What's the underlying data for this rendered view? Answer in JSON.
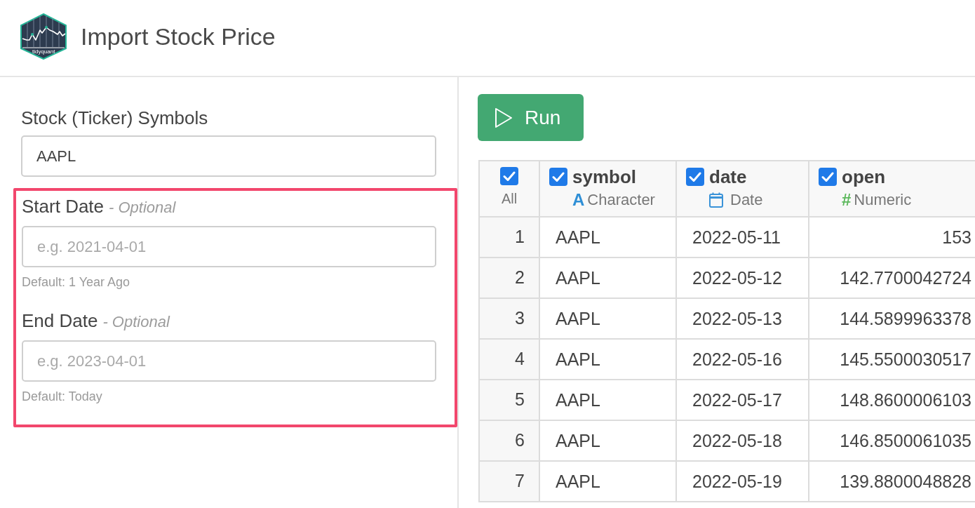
{
  "header": {
    "logo_text": "tidyquant",
    "title": "Import Stock Price"
  },
  "symbols_field": {
    "label": "Stock (Ticker) Symbols",
    "value": "AAPL"
  },
  "date_group": {
    "highlighted": true,
    "fields": [
      {
        "label": "Start Date",
        "note": "- Optional",
        "placeholder": "e.g. 2021-04-01",
        "help": "Default: 1 Year Ago"
      },
      {
        "label": "End Date",
        "note": "- Optional",
        "placeholder": "e.g. 2023-04-01",
        "help": "Default: Today"
      }
    ]
  },
  "run_button": {
    "label": "Run"
  },
  "table": {
    "select_all": {
      "label": "All",
      "checked": true
    },
    "columns": [
      {
        "name": "symbol",
        "kind": "character",
        "type_symbol": "A",
        "type": "Character",
        "checked": true
      },
      {
        "name": "date",
        "kind": "date",
        "type": "Date",
        "checked": true
      },
      {
        "name": "open",
        "kind": "numeric",
        "type_symbol": "#",
        "type": "Numeric",
        "checked": true
      }
    ],
    "rows": [
      {
        "number": "1",
        "cells": [
          "AAPL",
          "2022-05-11",
          "153"
        ]
      },
      {
        "number": "2",
        "cells": [
          "AAPL",
          "2022-05-12",
          "142.7700042724"
        ]
      },
      {
        "number": "3",
        "cells": [
          "AAPL",
          "2022-05-13",
          "144.5899963378"
        ]
      },
      {
        "number": "4",
        "cells": [
          "AAPL",
          "2022-05-16",
          "145.5500030517"
        ]
      },
      {
        "number": "5",
        "cells": [
          "AAPL",
          "2022-05-17",
          "148.8600006103"
        ]
      },
      {
        "number": "6",
        "cells": [
          "AAPL",
          "2022-05-18",
          "146.8500061035"
        ]
      },
      {
        "number": "7",
        "cells": [
          "AAPL",
          "2022-05-19",
          "139.8800048828"
        ]
      }
    ]
  }
}
